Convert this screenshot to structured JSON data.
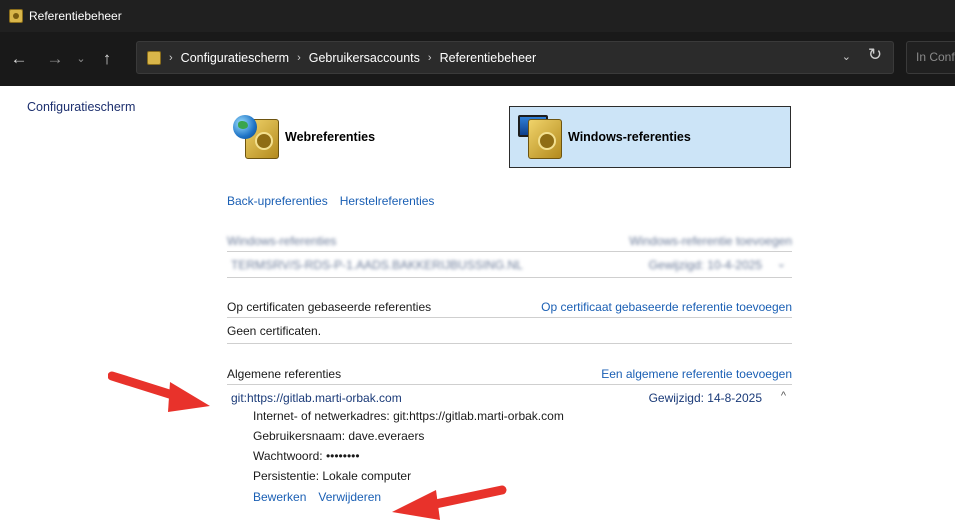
{
  "window": {
    "title": "Referentiebeheer"
  },
  "nav": {
    "back": "←",
    "forward": "→",
    "recent": "⌄",
    "up": "↑"
  },
  "address": {
    "crumb_sep": "›",
    "crumbs": [
      "Configuratiescherm",
      "Gebruikersaccounts",
      "Referentiebeheer"
    ],
    "dropdown": "⌄",
    "refresh": "↻",
    "search_placeholder": "In Configuratiescherm zoeken"
  },
  "sidebar": {
    "home_link": "Configuratiescherm"
  },
  "vaults": {
    "web": "Webreferenties",
    "windows": "Windows-referenties"
  },
  "actions": {
    "backup": "Back-upreferenties",
    "restore": "Herstelreferenties"
  },
  "windows_creds": {
    "title": "Windows-referenties",
    "add_label": "Windows-referentie toevoegen",
    "items": [
      {
        "name": "TERMSRV/S-RDS-P-1.AADS.BAKKERIJBUSSING.NL",
        "modified": "Gewijzigd:  10-4-2025",
        "chevron": "⌄"
      }
    ]
  },
  "cert_creds": {
    "title": "Op certificaten gebaseerde referenties",
    "add_label": "Op certificaat gebaseerde referentie toevoegen",
    "empty_text": "Geen certificaten."
  },
  "generic_creds": {
    "title": "Algemene referenties",
    "add_label": "Een algemene referentie toevoegen",
    "item": {
      "name": "git:https://gitlab.marti-orbak.com",
      "modified": "Gewijzigd:  14-8-2025",
      "chevron": "^",
      "address_label": "Internet- of netwerkadres:",
      "address_value": "git:https://gitlab.marti-orbak.com",
      "user_label": "Gebruikersnaam:",
      "user_value": "dave.everaers",
      "password_label": "Wachtwoord:",
      "password_value": "••••••••",
      "persist_label": "Persistentie:",
      "persist_value": "Lokale computer",
      "edit": "Bewerken",
      "remove": "Verwijderen"
    }
  },
  "colors": {
    "accent_link": "#1a5fb4",
    "selected_vault": "#cce4f7",
    "arrow": "#e8322b",
    "titlebar": "#202020"
  },
  "icons": [
    "credential-manager-icon",
    "back-arrow-icon",
    "forward-arrow-icon",
    "chevron-down-icon",
    "up-arrow-icon",
    "refresh-icon",
    "globe-safe-icon",
    "monitor-safe-icon",
    "red-arrow-annotation"
  ]
}
